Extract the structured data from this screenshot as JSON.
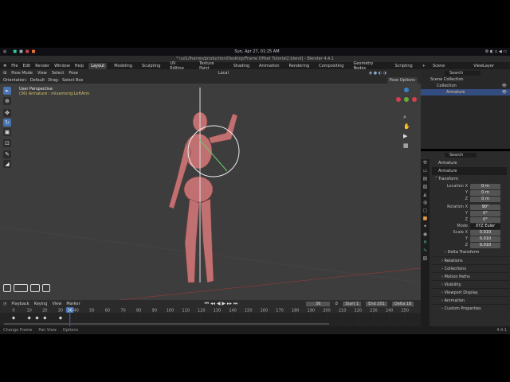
{
  "system": {
    "datetime": "Sun, Apr 27, 01:25 AM"
  },
  "window": {
    "title": "* lud1/Iharres/production/Desktop/Frame Offset Tutorial2.blend] - Blender 4.4.1"
  },
  "menu": [
    "File",
    "Edit",
    "Render",
    "Window",
    "Help"
  ],
  "workspaces": [
    "Layout",
    "Modeling",
    "Sculpting",
    "UV Editing",
    "Texture Paint",
    "Shading",
    "Animation",
    "Rendering",
    "Compositing",
    "Geometry Nodes",
    "Scripting",
    "+"
  ],
  "scene": {
    "scene_label": "Scene",
    "view_layer": "ViewLayer"
  },
  "viewport_header": {
    "mode": "Pose Mode",
    "menus": [
      "View",
      "Select",
      "Pose"
    ],
    "transform_space": "Local",
    "pose_options": "Pose Options"
  },
  "viewport_header2": {
    "orientation_label": "Orientation:",
    "orientation": "Default",
    "drag_label": "Drag:",
    "drag": "Select Box"
  },
  "viewport": {
    "title": "User Perspective",
    "subtitle": "(36) Armature : mixamorig:LeftArm"
  },
  "outliner": {
    "search_placeholder": "Search",
    "items": [
      "Scene Collection",
      "Collection",
      "Armature"
    ]
  },
  "properties": {
    "search_placeholder": "Search",
    "object": "Armature",
    "data": "Armature",
    "transform_label": "Transform",
    "location": {
      "label": "Location X",
      "x": "0 m",
      "y": "0 m",
      "z": "0 m"
    },
    "rotation": {
      "label": "Rotation X",
      "x": "90°",
      "y": "0°",
      "z": "0°"
    },
    "mode": {
      "label": "Mode",
      "value": "XYZ Euler"
    },
    "scale": {
      "label": "Scale X",
      "x": "0.010",
      "y": "0.010",
      "z": "0.010"
    },
    "axis_y": "Y",
    "axis_z": "Z",
    "delta": "Delta Transform",
    "sections": [
      "Relations",
      "Collections",
      "Motion Paths",
      "Visibility",
      "Viewport Display",
      "Animation",
      "Custom Properties"
    ]
  },
  "timeline": {
    "menus": [
      "Playback",
      "Keying",
      "View",
      "Marker"
    ],
    "current_frame": "36",
    "start_label": "Start",
    "start": "1",
    "end_label": "End",
    "end": "201",
    "delta_label": "Delta",
    "delta": "18",
    "ticks": [
      "0",
      "10",
      "20",
      "30",
      "40",
      "50",
      "60",
      "70",
      "80",
      "90",
      "100",
      "110",
      "120",
      "130",
      "140",
      "150",
      "160",
      "170",
      "180",
      "190",
      "200",
      "210",
      "220",
      "230",
      "240",
      "250"
    ],
    "keyframes": [
      0,
      10,
      15,
      20,
      30
    ]
  },
  "status": {
    "items": [
      "Change Frame",
      "Pan View",
      "Options"
    ],
    "version": "4.4.1"
  }
}
